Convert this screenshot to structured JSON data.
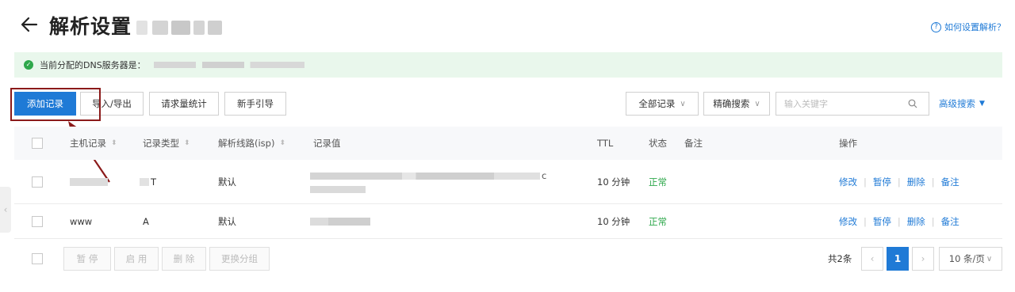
{
  "header": {
    "title": "解析设置",
    "help_link": "如何设置解析？",
    "help_icon": "question-circle-icon"
  },
  "banner": {
    "text": "当前分配的DNS服务器是：",
    "status_color": "#2ea84b"
  },
  "toolbar": {
    "add_record": "添加记录",
    "import_export": "导入/导出",
    "request_stats": "请求量统计",
    "beginner_guide": "新手引导",
    "filter_all": "全部记录",
    "precise_search": "精确搜索",
    "search_placeholder": "输入关键字",
    "advanced_search": "高级搜索"
  },
  "table": {
    "columns": {
      "host": "主机记录",
      "type": "记录类型",
      "line": "解析线路(isp)",
      "value": "记录值",
      "ttl": "TTL",
      "status": "状态",
      "remark": "备注",
      "actions": "操作"
    },
    "rows": [
      {
        "host": "",
        "type": "T",
        "line": "默认",
        "value_text": "c",
        "ttl": "10 分钟",
        "status": "正常",
        "remark": "",
        "actions": [
          "修改",
          "暂停",
          "删除",
          "备注"
        ]
      },
      {
        "host": "www",
        "type": "A",
        "line": "默认",
        "value_text": "",
        "ttl": "10 分钟",
        "status": "正常",
        "remark": "",
        "actions": [
          "修改",
          "暂停",
          "删除",
          "备注"
        ]
      }
    ]
  },
  "footer": {
    "pause": "暂 停",
    "enable": "启 用",
    "delete": "删 除",
    "change_group": "更换分组",
    "total": "共2条",
    "current_page": "1",
    "page_size": "10 条/页"
  },
  "colors": {
    "accent": "#1f7ad6",
    "annotation": "#8b1a1a",
    "banner_bg": "#e9f7ec"
  }
}
